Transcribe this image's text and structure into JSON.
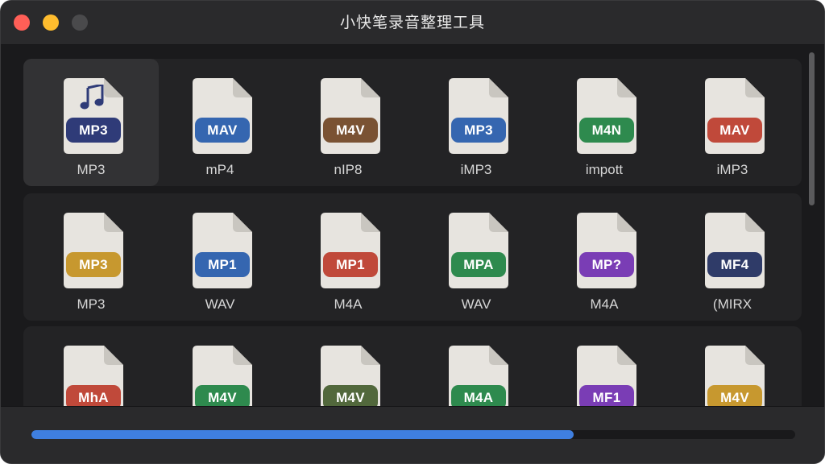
{
  "window": {
    "title": "小快笔录音整理工具"
  },
  "colors": {
    "close": "#ff5f57",
    "minimize": "#febc2e",
    "zoom": "#4a4a4c",
    "progress": "#3f7fe0"
  },
  "progress": {
    "fraction": 0.71
  },
  "rows": [
    [
      {
        "badge": "MP3",
        "color": "#2f3b78",
        "label": "MP3",
        "music_icon": true,
        "selected": true
      },
      {
        "badge": "MAV",
        "color": "#3566b0",
        "label": "mP4"
      },
      {
        "badge": "M4V",
        "color": "#7a5233",
        "label": "nIP8"
      },
      {
        "badge": "MP3",
        "color": "#3566b0",
        "label": "iMP3"
      },
      {
        "badge": "M4N",
        "color": "#2e8a4e",
        "label": "impott"
      },
      {
        "badge": "MAV",
        "color": "#c0493a",
        "label": "iMP3"
      }
    ],
    [
      {
        "badge": "MP3",
        "color": "#c7982f",
        "label": "MP3"
      },
      {
        "badge": "MP1",
        "color": "#3566b0",
        "label": "WAV"
      },
      {
        "badge": "MP1",
        "color": "#c0493a",
        "label": "M4A"
      },
      {
        "badge": "MPA",
        "color": "#2e8a4e",
        "label": "WAV"
      },
      {
        "badge": "MP?",
        "color": "#7a3db5",
        "label": "M4A"
      },
      {
        "badge": "MF4",
        "color": "#2f3b68",
        "label": "(MIRX"
      }
    ],
    [
      {
        "badge": "MhA",
        "color": "#c0493a",
        "label": ""
      },
      {
        "badge": "M4V",
        "color": "#2e8a4e",
        "label": ""
      },
      {
        "badge": "M4V",
        "color": "#52683c",
        "label": ""
      },
      {
        "badge": "M4A",
        "color": "#2e8a4e",
        "label": ""
      },
      {
        "badge": "MF1",
        "color": "#7a3db5",
        "label": ""
      },
      {
        "badge": "M4V",
        "color": "#c7982f",
        "label": ""
      }
    ]
  ]
}
